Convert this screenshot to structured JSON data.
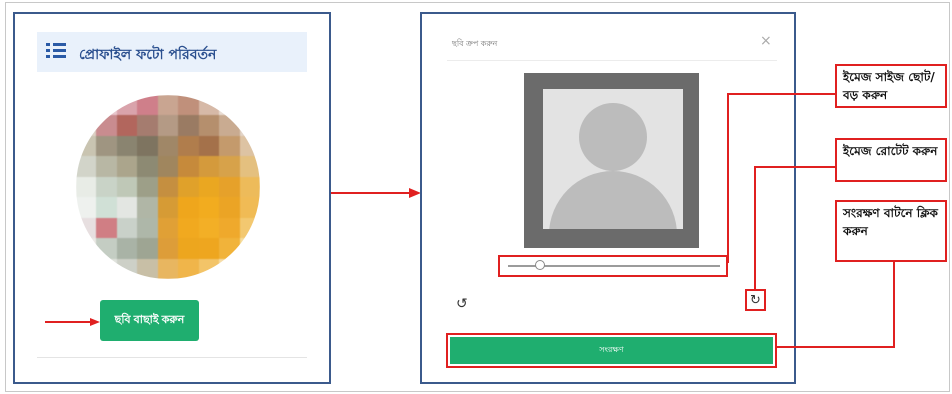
{
  "left_panel": {
    "header_title": "প্রোফাইল ফটো পরিবর্তন",
    "choose_button": "ছবি বাছাই করুন"
  },
  "modal": {
    "title": "ছবি ক্রপ করুন",
    "close_glyph": "×",
    "rotate_left_glyph": "↺",
    "rotate_right_glyph": "↻",
    "save_button": "সংরক্ষণ",
    "zoom_slider_value": 0.15
  },
  "callouts": [
    {
      "text": "ইমেজ সাইজ ছোট/বড় করুন"
    },
    {
      "text": "ইমেজ রোটেট করুন"
    },
    {
      "text": "সংরক্ষণ বাটনে ক্লিক করুন"
    }
  ],
  "colors": {
    "accent_green": "#1fae6f",
    "annotation_red": "#e02020",
    "panel_border": "#3b5a8c",
    "header_bg": "#e9f1fb"
  },
  "icons": {
    "header": "list-icon",
    "rotate_left": "rotate-left-icon",
    "rotate_right": "rotate-right-icon",
    "close": "close-icon",
    "placeholder": "user-silhouette-icon"
  }
}
